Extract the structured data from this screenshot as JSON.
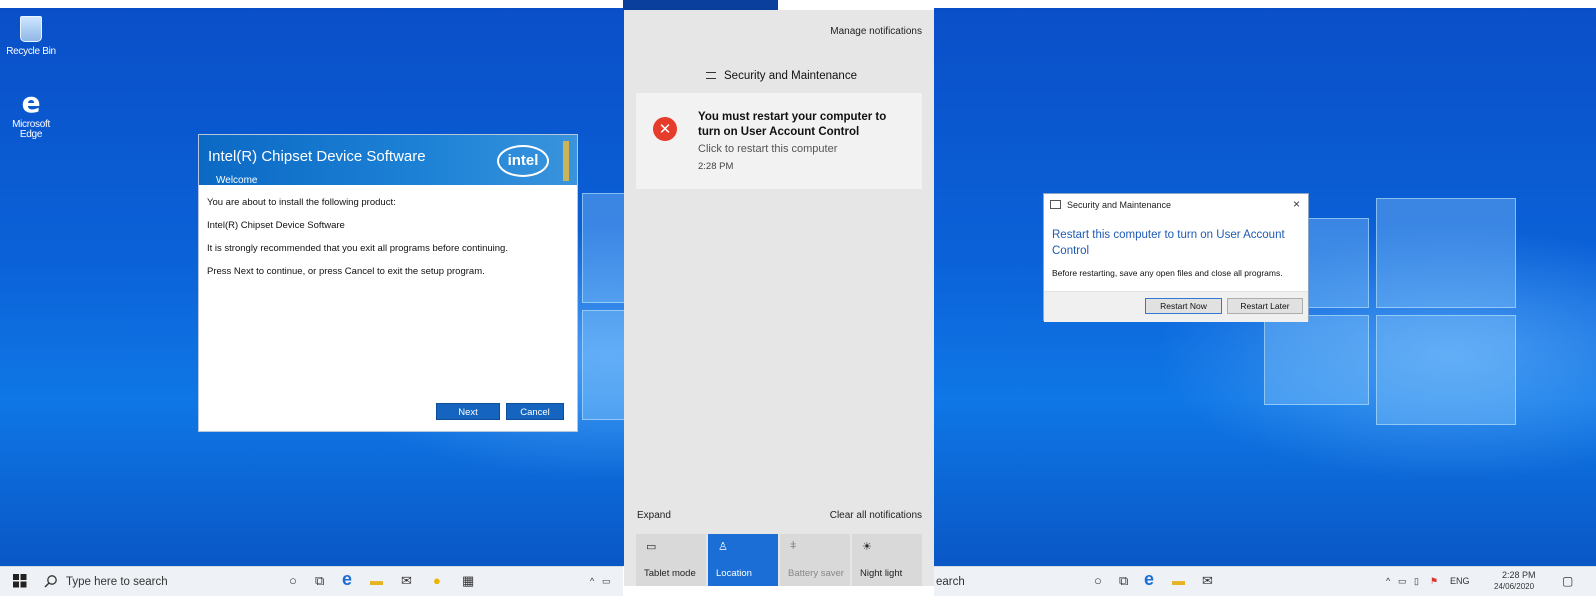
{
  "desktop": {
    "icons": [
      {
        "label": "Recycle Bin"
      },
      {
        "label": "Microsoft Edge"
      }
    ]
  },
  "intel_dialog": {
    "title": "Intel(R) Chipset Device Software",
    "subtitle": "Welcome",
    "logo_text": "intel",
    "lines": [
      "You are about to install the following product:",
      "Intel(R) Chipset Device Software",
      "It is strongly recommended that you exit all programs before continuing.",
      "Press Next to continue, or press Cancel to exit the setup program."
    ],
    "next_label": "Next",
    "cancel_label": "Cancel"
  },
  "action_center": {
    "manage_label": "Manage notifications",
    "group_title": "Security and Maintenance",
    "notification": {
      "title": "You must restart your computer to turn on User Account Control",
      "subtitle": "Click to restart this computer",
      "time": "2:28 PM"
    },
    "expand_label": "Expand",
    "clear_label": "Clear all notifications",
    "tiles": [
      {
        "label": "Tablet mode",
        "icon": "tablet-icon",
        "state": "off"
      },
      {
        "label": "Location",
        "icon": "location-icon",
        "state": "on"
      },
      {
        "label": "Battery saver",
        "icon": "battery-icon",
        "state": "disabled"
      },
      {
        "label": "Night light",
        "icon": "sun-icon",
        "state": "off"
      }
    ]
  },
  "sm_dialog": {
    "title": "Security and Maintenance",
    "close_glyph": "×",
    "heading": "Restart this computer to turn on User Account Control",
    "text": "Before restarting, save any open files and close all programs.",
    "restart_now_label": "Restart Now",
    "restart_later_label": "Restart Later"
  },
  "taskbar_left": {
    "search_placeholder": "Type here to search"
  },
  "taskbar_right": {
    "search_fragment": "earch",
    "language": "ENG",
    "time": "2:28 PM",
    "date": "24/06/2020"
  },
  "colors": {
    "accent": "#1a6ed6",
    "error": "#e63c2b",
    "link_blue": "#1e5bb5"
  }
}
